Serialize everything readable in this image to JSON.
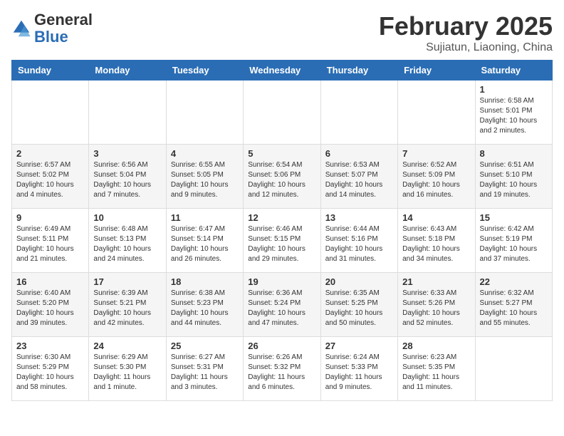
{
  "header": {
    "logo_general": "General",
    "logo_blue": "Blue",
    "month_title": "February 2025",
    "subtitle": "Sujiatun, Liaoning, China"
  },
  "days_of_week": [
    "Sunday",
    "Monday",
    "Tuesday",
    "Wednesday",
    "Thursday",
    "Friday",
    "Saturday"
  ],
  "weeks": [
    [
      {
        "num": "",
        "info": ""
      },
      {
        "num": "",
        "info": ""
      },
      {
        "num": "",
        "info": ""
      },
      {
        "num": "",
        "info": ""
      },
      {
        "num": "",
        "info": ""
      },
      {
        "num": "",
        "info": ""
      },
      {
        "num": "1",
        "info": "Sunrise: 6:58 AM\nSunset: 5:01 PM\nDaylight: 10 hours and 2 minutes."
      }
    ],
    [
      {
        "num": "2",
        "info": "Sunrise: 6:57 AM\nSunset: 5:02 PM\nDaylight: 10 hours and 4 minutes."
      },
      {
        "num": "3",
        "info": "Sunrise: 6:56 AM\nSunset: 5:04 PM\nDaylight: 10 hours and 7 minutes."
      },
      {
        "num": "4",
        "info": "Sunrise: 6:55 AM\nSunset: 5:05 PM\nDaylight: 10 hours and 9 minutes."
      },
      {
        "num": "5",
        "info": "Sunrise: 6:54 AM\nSunset: 5:06 PM\nDaylight: 10 hours and 12 minutes."
      },
      {
        "num": "6",
        "info": "Sunrise: 6:53 AM\nSunset: 5:07 PM\nDaylight: 10 hours and 14 minutes."
      },
      {
        "num": "7",
        "info": "Sunrise: 6:52 AM\nSunset: 5:09 PM\nDaylight: 10 hours and 16 minutes."
      },
      {
        "num": "8",
        "info": "Sunrise: 6:51 AM\nSunset: 5:10 PM\nDaylight: 10 hours and 19 minutes."
      }
    ],
    [
      {
        "num": "9",
        "info": "Sunrise: 6:49 AM\nSunset: 5:11 PM\nDaylight: 10 hours and 21 minutes."
      },
      {
        "num": "10",
        "info": "Sunrise: 6:48 AM\nSunset: 5:13 PM\nDaylight: 10 hours and 24 minutes."
      },
      {
        "num": "11",
        "info": "Sunrise: 6:47 AM\nSunset: 5:14 PM\nDaylight: 10 hours and 26 minutes."
      },
      {
        "num": "12",
        "info": "Sunrise: 6:46 AM\nSunset: 5:15 PM\nDaylight: 10 hours and 29 minutes."
      },
      {
        "num": "13",
        "info": "Sunrise: 6:44 AM\nSunset: 5:16 PM\nDaylight: 10 hours and 31 minutes."
      },
      {
        "num": "14",
        "info": "Sunrise: 6:43 AM\nSunset: 5:18 PM\nDaylight: 10 hours and 34 minutes."
      },
      {
        "num": "15",
        "info": "Sunrise: 6:42 AM\nSunset: 5:19 PM\nDaylight: 10 hours and 37 minutes."
      }
    ],
    [
      {
        "num": "16",
        "info": "Sunrise: 6:40 AM\nSunset: 5:20 PM\nDaylight: 10 hours and 39 minutes."
      },
      {
        "num": "17",
        "info": "Sunrise: 6:39 AM\nSunset: 5:21 PM\nDaylight: 10 hours and 42 minutes."
      },
      {
        "num": "18",
        "info": "Sunrise: 6:38 AM\nSunset: 5:23 PM\nDaylight: 10 hours and 44 minutes."
      },
      {
        "num": "19",
        "info": "Sunrise: 6:36 AM\nSunset: 5:24 PM\nDaylight: 10 hours and 47 minutes."
      },
      {
        "num": "20",
        "info": "Sunrise: 6:35 AM\nSunset: 5:25 PM\nDaylight: 10 hours and 50 minutes."
      },
      {
        "num": "21",
        "info": "Sunrise: 6:33 AM\nSunset: 5:26 PM\nDaylight: 10 hours and 52 minutes."
      },
      {
        "num": "22",
        "info": "Sunrise: 6:32 AM\nSunset: 5:27 PM\nDaylight: 10 hours and 55 minutes."
      }
    ],
    [
      {
        "num": "23",
        "info": "Sunrise: 6:30 AM\nSunset: 5:29 PM\nDaylight: 10 hours and 58 minutes."
      },
      {
        "num": "24",
        "info": "Sunrise: 6:29 AM\nSunset: 5:30 PM\nDaylight: 11 hours and 1 minute."
      },
      {
        "num": "25",
        "info": "Sunrise: 6:27 AM\nSunset: 5:31 PM\nDaylight: 11 hours and 3 minutes."
      },
      {
        "num": "26",
        "info": "Sunrise: 6:26 AM\nSunset: 5:32 PM\nDaylight: 11 hours and 6 minutes."
      },
      {
        "num": "27",
        "info": "Sunrise: 6:24 AM\nSunset: 5:33 PM\nDaylight: 11 hours and 9 minutes."
      },
      {
        "num": "28",
        "info": "Sunrise: 6:23 AM\nSunset: 5:35 PM\nDaylight: 11 hours and 11 minutes."
      },
      {
        "num": "",
        "info": ""
      }
    ]
  ]
}
